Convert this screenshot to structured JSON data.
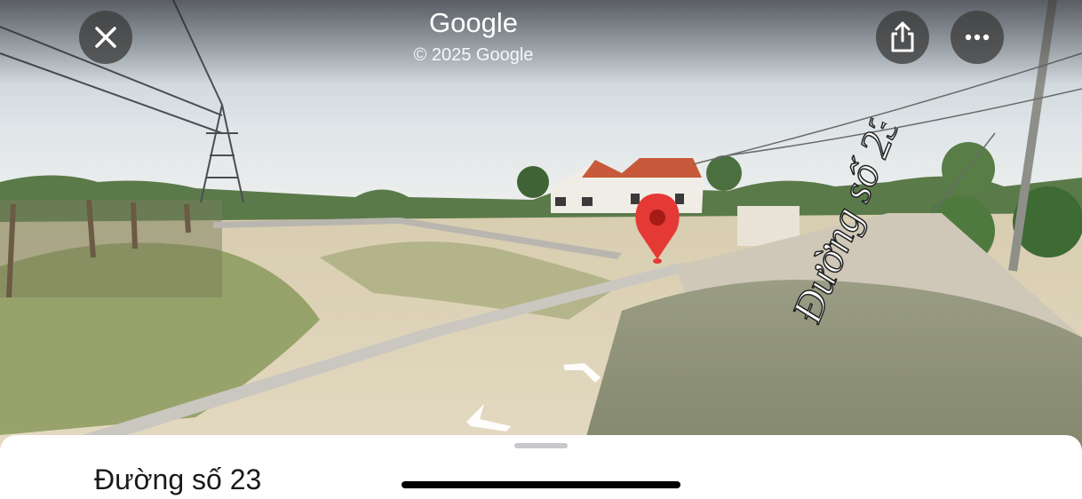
{
  "header": {
    "provider": "Google",
    "copyright": "© 2025 Google"
  },
  "controls": {
    "close_icon": "close-icon",
    "share_icon": "share-icon",
    "more_icon": "more-icon"
  },
  "road_marking": "Đường số 23",
  "sheet": {
    "place_title": "Đường số 23"
  },
  "colors": {
    "pin": "#e53935",
    "button_bg": "#3c3c3c",
    "sheet_bg": "#ffffff"
  }
}
